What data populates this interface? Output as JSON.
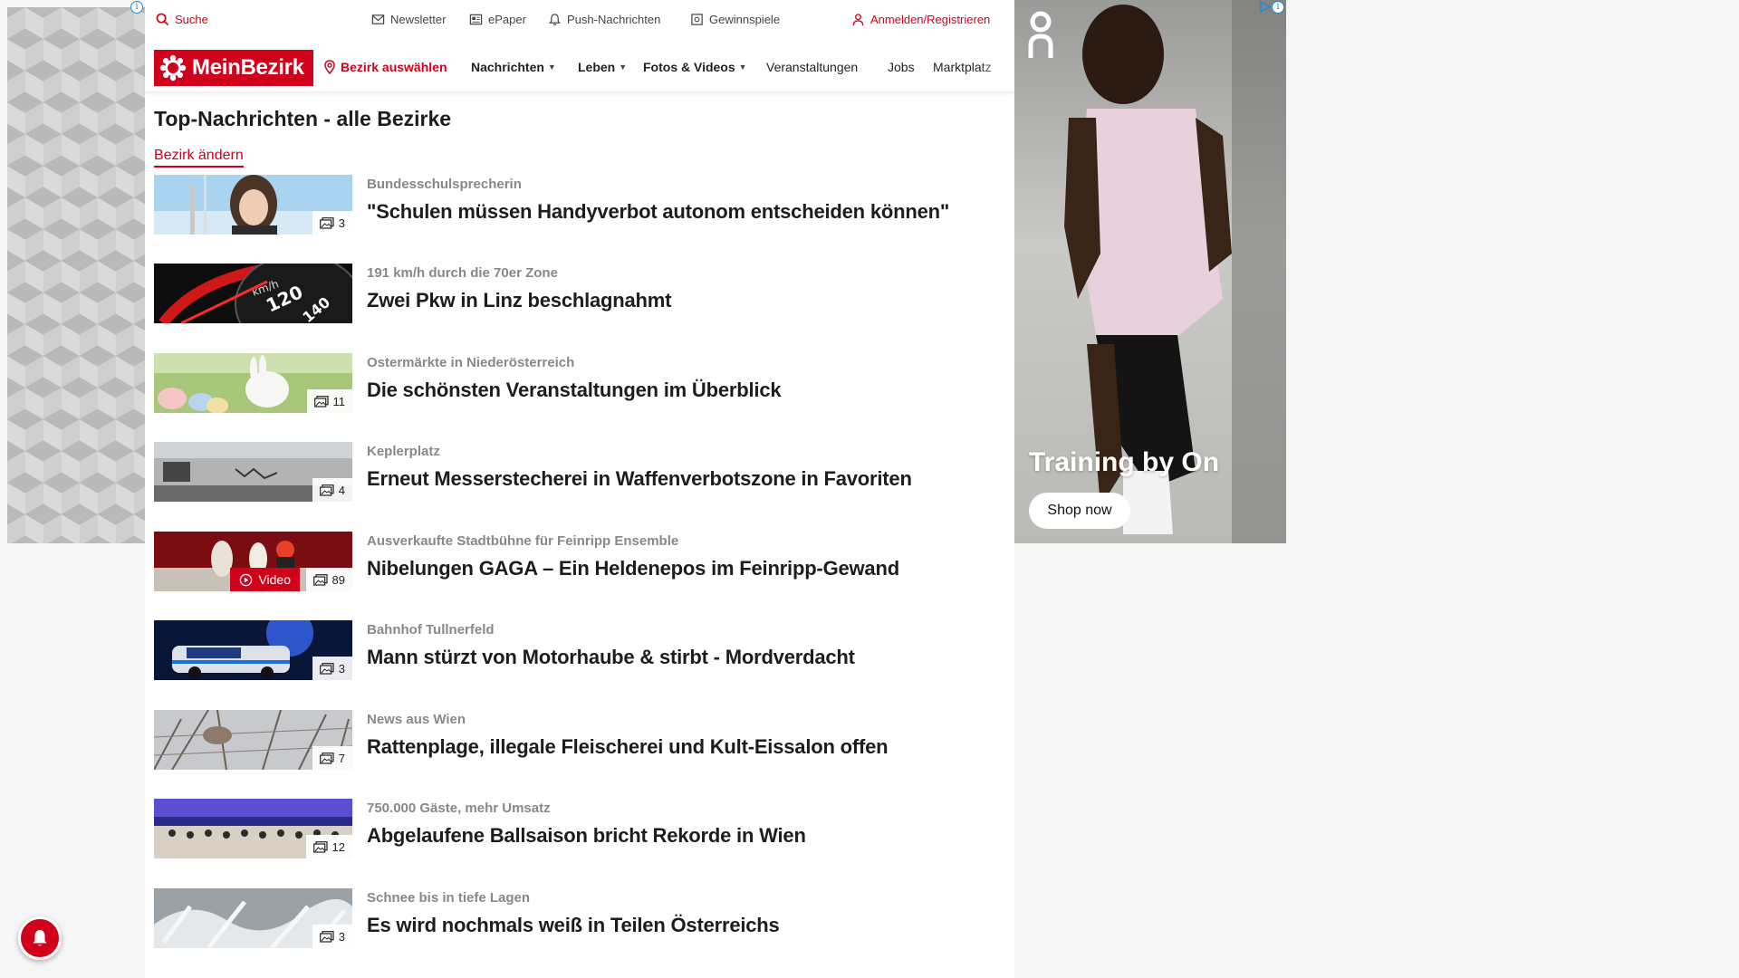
{
  "topbar": {
    "search": "Suche",
    "newsletter": "Newsletter",
    "epaper": "ePaper",
    "push": "Push-Nachrichten",
    "gewinnspiele": "Gewinnspiele",
    "login": "Anmelden/Registrieren"
  },
  "navbar": {
    "logo": "MeinBezirk",
    "bezirk": "Bezirk auswählen",
    "items": [
      "Nachrichten",
      "Leben",
      "Fotos & Videos",
      "Veranstaltungen",
      "Jobs",
      "Marktplatz"
    ]
  },
  "page": {
    "title": "Top-Nachrichten - alle Bezirke",
    "change_link": "Bezirk ändern"
  },
  "articles": [
    {
      "kicker": "Bundesschulsprecherin",
      "headline": "\"Schulen müssen Handyverbot autonom entscheiden können\"",
      "images": "3"
    },
    {
      "kicker": "191 km/h durch die 70er Zone",
      "headline": "Zwei Pkw in Linz beschlagnahmt",
      "images": ""
    },
    {
      "kicker": "Ostermärkte in Niederösterreich",
      "headline": "Die schönsten Veranstaltungen im Überblick",
      "images": "11"
    },
    {
      "kicker": "Keplerplatz",
      "headline": "Erneut Messerstecherei in Waffenverbotszone in Favoriten",
      "images": "4"
    },
    {
      "kicker": "Ausverkaufte Stadtbühne für Feinripp Ensemble",
      "headline": "Nibelungen GAGA – Ein Heldenepos im Feinripp-Gewand",
      "images": "89",
      "video": "Video"
    },
    {
      "kicker": "Bahnhof Tullnerfeld",
      "headline": "Mann stürzt von Motorhaube & stirbt - Mordverdacht",
      "images": "3"
    },
    {
      "kicker": "News aus Wien",
      "headline": "Rattenplage, illegale Fleischerei und Kult-Eissalon offen",
      "images": "7"
    },
    {
      "kicker": "750.000 Gäste, mehr Umsatz",
      "headline": "Abgelaufene Ballsaison bricht Rekorde in Wien",
      "images": "12"
    },
    {
      "kicker": "Schnee bis in tiefe Lagen",
      "headline": "Es wird nochmals weiß in Teilen Österreichs",
      "images": "3"
    }
  ],
  "ad_right": {
    "text": "Training by On",
    "button": "Shop now"
  },
  "colors": {
    "brand": "#d0021b",
    "kicker": "#888888",
    "headline": "#1d1d1d"
  },
  "icons": {
    "search": "search-icon",
    "newsletter": "envelope-icon",
    "epaper": "newspaper-icon",
    "push": "bell-icon",
    "gewinnspiele": "gift-icon",
    "login": "user-icon",
    "bezirk": "location-pin-icon",
    "gallery": "image-gallery-icon",
    "video": "play-icon"
  }
}
